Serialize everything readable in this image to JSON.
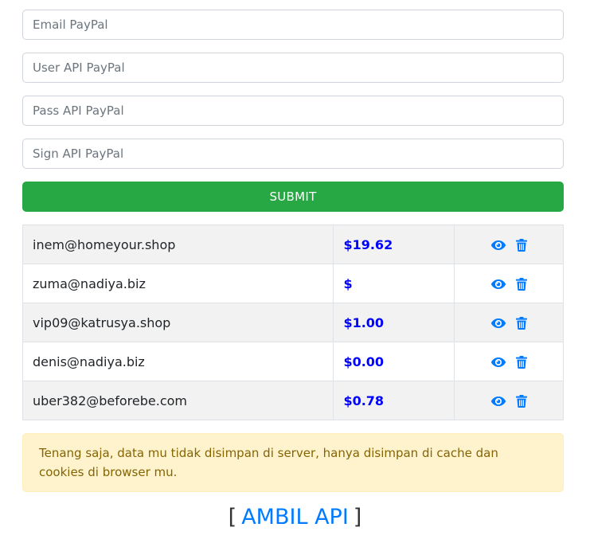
{
  "form": {
    "email_placeholder": "Email PayPal",
    "user_api_placeholder": "User API PayPal",
    "pass_api_placeholder": "Pass API PayPal",
    "sign_api_placeholder": "Sign API PayPal",
    "submit_label": "SUBMIT"
  },
  "accounts": [
    {
      "email": "inem@homeyour.shop",
      "balance": "$19.62"
    },
    {
      "email": "zuma@nadiya.biz",
      "balance": "$"
    },
    {
      "email": "vip09@katrusya.shop",
      "balance": "$1.00"
    },
    {
      "email": "denis@nadiya.biz",
      "balance": "$0.00"
    },
    {
      "email": "uber382@beforebe.com",
      "balance": "$0.78"
    }
  ],
  "row_icons": [
    "eye-icon",
    "trash-icon"
  ],
  "notice": "Tenang saja, data mu tidak disimpan di server, hanya disimpan di cache dan cookies di browser mu.",
  "ambil_api": {
    "open_bracket": "[",
    "label": "AMBIL API",
    "close_bracket": "]"
  },
  "colors": {
    "submit": "#28a745",
    "balance": "#0000ff",
    "icon": "#007bff",
    "alert_bg": "#fff3cd",
    "alert_text": "#856404"
  }
}
